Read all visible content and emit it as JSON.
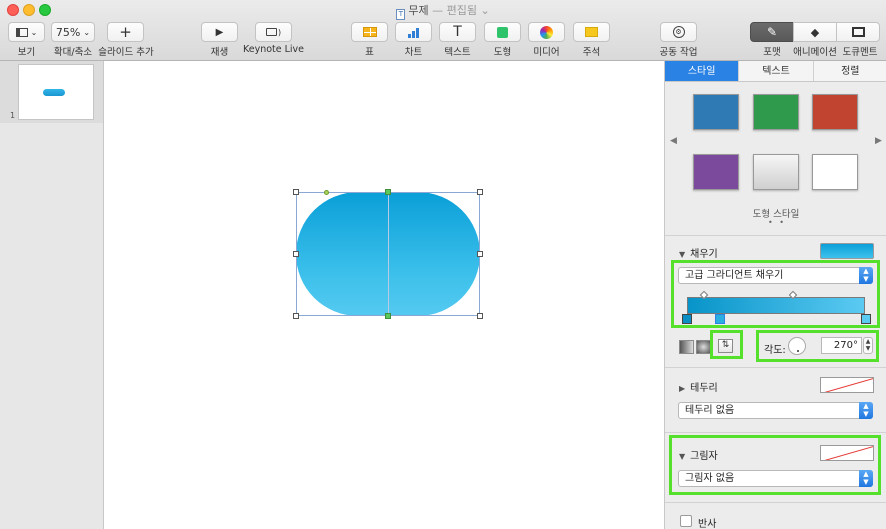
{
  "window": {
    "title": "무제",
    "title_sep": "—",
    "status": "편집됨"
  },
  "toolbar": {
    "view_label": "보기",
    "zoom_value": "75%",
    "zoom_label": "확대/축소",
    "add_slide_label": "슬라이드 추가",
    "play_label": "재생",
    "keynote_live_label": "Keynote Live",
    "table_label": "표",
    "chart_label": "차트",
    "text_label": "텍스트",
    "shape_label": "도형",
    "media_label": "미디어",
    "comment_label": "주석",
    "collaborate_label": "공동 작업",
    "format_label": "포맷",
    "animate_label": "애니메이션",
    "document_label": "도큐멘트"
  },
  "navigator": {
    "slide_number": "1"
  },
  "inspector": {
    "tabs": [
      "스타일",
      "텍스트",
      "정렬"
    ],
    "shape_styles_label": "도형 스타일",
    "style_swatches": [
      "#2f7ab4",
      "#2f9a4b",
      "#c0442f",
      "#7b4a9c",
      "#e6e6e6",
      "#ffffff"
    ],
    "fill": {
      "title": "채우기",
      "type": "고급 그라디언트 채우기",
      "gradient_start": "#0894c9",
      "gradient_end": "#5bcaf2",
      "angle_label": "각도:",
      "angle_value": "270°"
    },
    "border": {
      "title": "테두리",
      "value": "테두리 없음"
    },
    "shadow": {
      "title": "그림자",
      "value": "그림자 없음"
    },
    "reflection": {
      "title": "반사"
    }
  },
  "colors": {
    "accent": "#2a82e4",
    "highlight": "#55e02c",
    "shape_top": "#0a9fd8",
    "shape_bottom": "#55c9f0"
  }
}
